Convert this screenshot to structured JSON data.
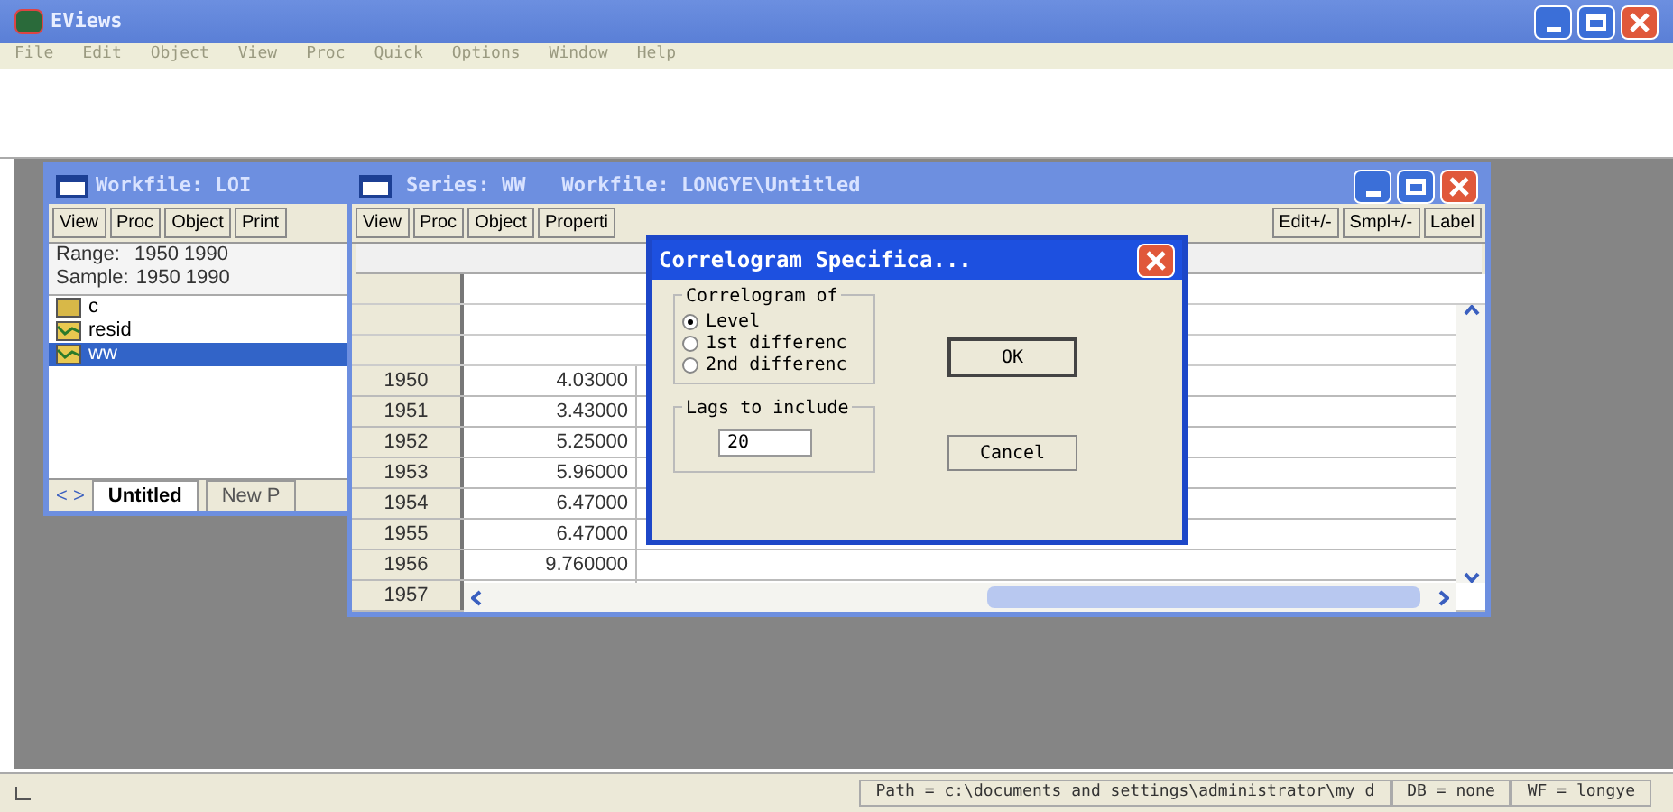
{
  "app": {
    "title": "EViews"
  },
  "menu": [
    "File",
    "Edit",
    "Object",
    "View",
    "Proc",
    "Quick",
    "Options",
    "Window",
    "Help"
  ],
  "workfile_window": {
    "title": "Workfile: LOI",
    "toolbar": [
      "View",
      "Proc",
      "Object",
      "Print"
    ],
    "range_label": "Range:",
    "range": "1950 1990",
    "sample_label": "Sample:",
    "sample": "1950 1990",
    "objects": [
      {
        "name": "c",
        "kind": "coef",
        "selected": false
      },
      {
        "name": "resid",
        "kind": "series",
        "selected": false
      },
      {
        "name": "ww",
        "kind": "series",
        "selected": true
      }
    ],
    "tab_nav": "< >",
    "tabs": [
      {
        "label": "Untitled",
        "selected": true
      },
      {
        "label": "New P",
        "selected": false
      }
    ]
  },
  "series_window": {
    "title": "Series: WW",
    "subtitle": "Workfile: LONGYE\\Untitled",
    "toolbar_left": [
      "View",
      "Proc",
      "Object",
      "Properti"
    ],
    "toolbar_right": [
      "Edit+/-",
      "Smpl+/-",
      "Label"
    ],
    "rows": [
      {
        "year": "1950",
        "value": "4.03000"
      },
      {
        "year": "1951",
        "value": "3.43000"
      },
      {
        "year": "1952",
        "value": "5.25000"
      },
      {
        "year": "1953",
        "value": "5.96000"
      },
      {
        "year": "1954",
        "value": "6.47000"
      },
      {
        "year": "1955",
        "value": "6.47000"
      },
      {
        "year": "1956",
        "value": "9.760000"
      },
      {
        "year": "1957",
        "value": ""
      }
    ]
  },
  "dialog": {
    "title": "Correlogram Specifica...",
    "group_label": "Correlogram of",
    "options": [
      {
        "label": "Level",
        "selected": true
      },
      {
        "label": "1st differenc",
        "selected": false
      },
      {
        "label": "2nd differenc",
        "selected": false
      }
    ],
    "lags_label": "Lags to include",
    "lags_value": "20",
    "ok": "OK",
    "cancel": "Cancel"
  },
  "status_bar": {
    "path": "Path = c:\\documents and settings\\administrator\\my d",
    "db": "DB = none",
    "wf": "WF = longye"
  }
}
